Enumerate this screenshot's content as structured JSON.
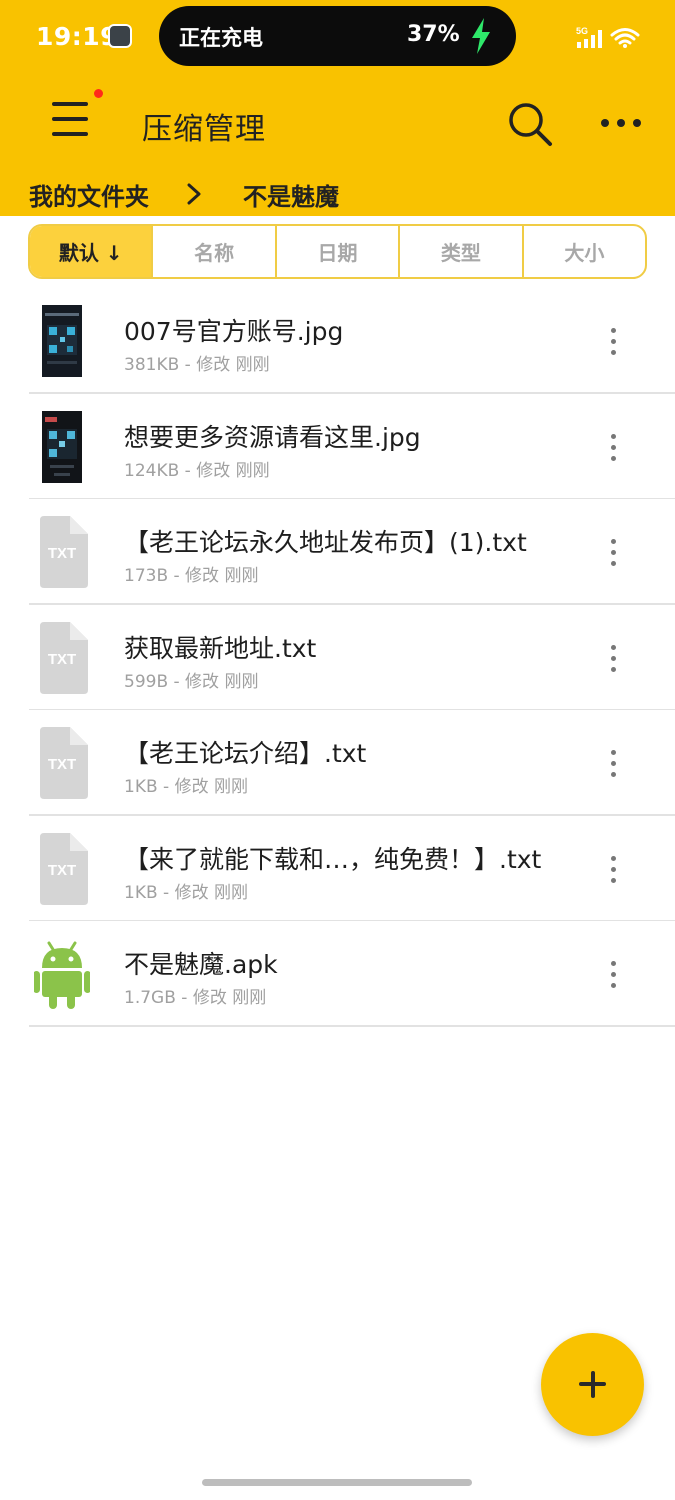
{
  "status_bar": {
    "time": "19:19",
    "island_text": "正在充电",
    "battery_percent": "37%",
    "network_label": "5G"
  },
  "header": {
    "title": "压缩管理",
    "menu_has_notification": true
  },
  "breadcrumb": {
    "root": "我的文件夹",
    "current": "不是魅魔"
  },
  "sort_tabs": [
    {
      "label": "默认 ↓",
      "active": true
    },
    {
      "label": "名称",
      "active": false
    },
    {
      "label": "日期",
      "active": false
    },
    {
      "label": "类型",
      "active": false
    },
    {
      "label": "大小",
      "active": false
    }
  ],
  "files": [
    {
      "name": "007号官方账号.jpg",
      "meta": "381KB - 修改 刚刚",
      "icon": "image-thumbnail-icon"
    },
    {
      "name": "想要更多资源请看这里.jpg",
      "meta": "124KB - 修改 刚刚",
      "icon": "image-thumbnail-icon"
    },
    {
      "name": "【老王论坛永久地址发布页】(1).txt",
      "meta": "173B - 修改 刚刚",
      "icon": "txt-file-icon",
      "icon_text": "TXT"
    },
    {
      "name": "获取最新地址.txt",
      "meta": "599B - 修改 刚刚",
      "icon": "txt-file-icon",
      "icon_text": "TXT"
    },
    {
      "name": "【老王论坛介绍】.txt",
      "meta": "1KB - 修改 刚刚",
      "icon": "txt-file-icon",
      "icon_text": "TXT"
    },
    {
      "name": "【来了就能下载和…，纯免费！】.txt",
      "meta": "1KB - 修改 刚刚",
      "icon": "txt-file-icon",
      "icon_text": "TXT"
    },
    {
      "name": "不是魅魔.apk",
      "meta": "1.7GB - 修改 刚刚",
      "icon": "android-icon"
    }
  ],
  "colors": {
    "accent": "#F9C200",
    "sort_active": "#FCD13D",
    "android_green": "#8BC34A",
    "charge_green": "#2EE86A"
  }
}
